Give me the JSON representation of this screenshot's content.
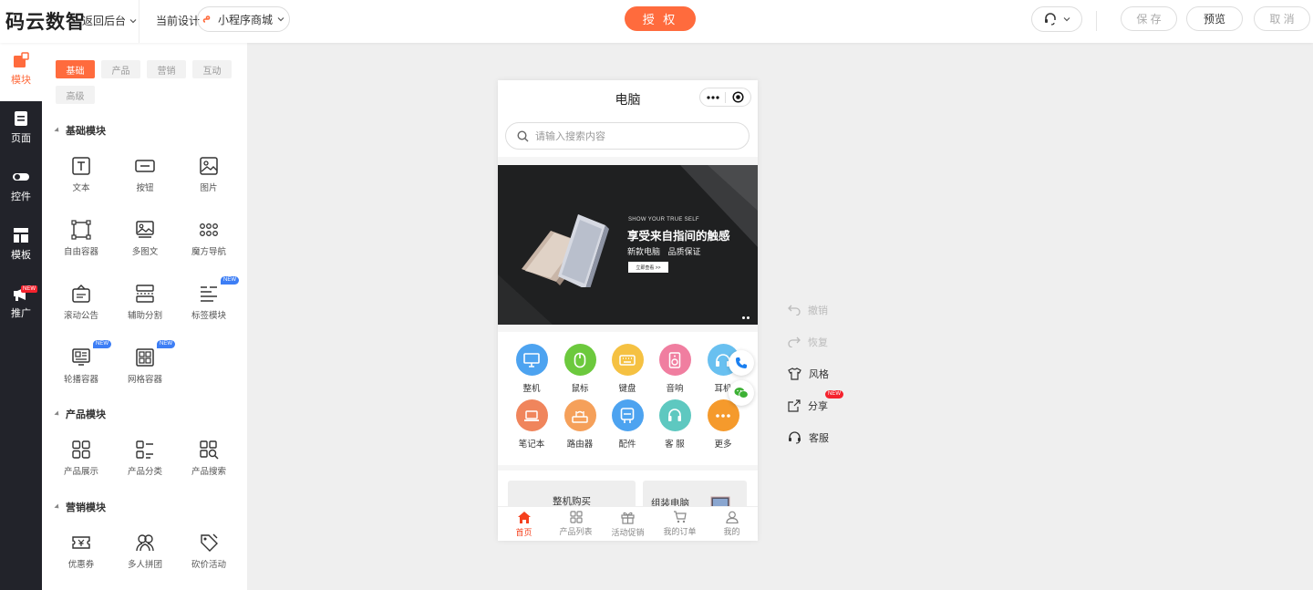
{
  "header": {
    "brand": "码云数智",
    "back_label": "返回后台",
    "current_design_label": "当前设计",
    "project_name": "小程序商城",
    "authorize_label": "授 权",
    "save_label": "保 存",
    "preview_label": "预览",
    "cancel_label": "取 消"
  },
  "rail": {
    "items": [
      {
        "label": "模块",
        "icon": "block-icon",
        "active": true
      },
      {
        "label": "页面",
        "icon": "page-icon"
      },
      {
        "label": "控件",
        "icon": "toggle-icon"
      },
      {
        "label": "模板",
        "icon": "template-icon"
      },
      {
        "label": "推广",
        "icon": "megaphone-icon",
        "badge": "NEW"
      }
    ]
  },
  "panel": {
    "tabs": [
      "基础",
      "产品",
      "营销",
      "互动",
      "高级"
    ],
    "active_tab": "基础",
    "sections": [
      {
        "title": "基础模块",
        "items": [
          {
            "label": "文本",
            "icon": "text-icon"
          },
          {
            "label": "按钮",
            "icon": "button-icon"
          },
          {
            "label": "图片",
            "icon": "image-icon"
          },
          {
            "label": "自由容器",
            "icon": "free-container-icon"
          },
          {
            "label": "多图文",
            "icon": "multi-image-icon"
          },
          {
            "label": "魔方导航",
            "icon": "grid-dots-icon"
          },
          {
            "label": "滚动公告",
            "icon": "notice-icon"
          },
          {
            "label": "辅助分割",
            "icon": "divider-icon"
          },
          {
            "label": "标签模块",
            "icon": "tag-list-icon",
            "badge": "NEW"
          },
          {
            "label": "轮播容器",
            "icon": "carousel-icon",
            "badge": "NEW"
          },
          {
            "label": "网格容器",
            "icon": "grid-container-icon",
            "badge": "NEW"
          }
        ]
      },
      {
        "title": "产品模块",
        "items": [
          {
            "label": "产品展示",
            "icon": "product-grid-icon"
          },
          {
            "label": "产品分类",
            "icon": "product-category-icon"
          },
          {
            "label": "产品搜索",
            "icon": "product-search-icon"
          }
        ]
      },
      {
        "title": "营销模块",
        "items": [
          {
            "label": "优惠券",
            "icon": "coupon-icon"
          },
          {
            "label": "多人拼团",
            "icon": "group-buy-icon"
          },
          {
            "label": "砍价活动",
            "icon": "bargain-icon"
          }
        ]
      }
    ]
  },
  "phone": {
    "title": "电脑",
    "search_placeholder": "请输入搜索内容",
    "banner": {
      "subtitle": "SHOW YOUR TRUE SELF",
      "title": "享受来自指间的触感",
      "tagline": "新款电脑 品质保证",
      "button": "立即查看 >>"
    },
    "categories": [
      {
        "label": "整机",
        "color": "#4da3f0",
        "icon": "monitor-icon"
      },
      {
        "label": "鼠标",
        "color": "#6cc93d",
        "icon": "mouse-icon"
      },
      {
        "label": "键盘",
        "color": "#f5c142",
        "icon": "keyboard-icon"
      },
      {
        "label": "音响",
        "color": "#f07ea0",
        "icon": "speaker-icon"
      },
      {
        "label": "耳机",
        "color": "#69c0f0",
        "icon": "headphone-icon"
      },
      {
        "label": "笔记本",
        "color": "#f0855c",
        "icon": "laptop-icon"
      },
      {
        "label": "路由器",
        "color": "#f5a05a",
        "icon": "router-icon"
      },
      {
        "label": "配件",
        "color": "#4da3f0",
        "icon": "accessory-icon"
      },
      {
        "label": "客 服",
        "color": "#5ec8c0",
        "icon": "support-icon"
      },
      {
        "label": "更多",
        "color": "#f59a2c",
        "icon": "more-icon"
      }
    ],
    "promo": [
      "整机购买",
      "组装电脑"
    ],
    "tabbar": [
      {
        "label": "首页",
        "icon": "home-icon",
        "active": true
      },
      {
        "label": "产品列表",
        "icon": "grid-icon"
      },
      {
        "label": "活动促销",
        "icon": "gift-icon"
      },
      {
        "label": "我的订单",
        "icon": "cart-icon"
      },
      {
        "label": "我的",
        "icon": "user-icon"
      }
    ]
  },
  "tools": {
    "undo": "撤销",
    "redo": "恢复",
    "style": "风格",
    "share": "分享",
    "share_badge": "NEW",
    "service": "客服"
  }
}
